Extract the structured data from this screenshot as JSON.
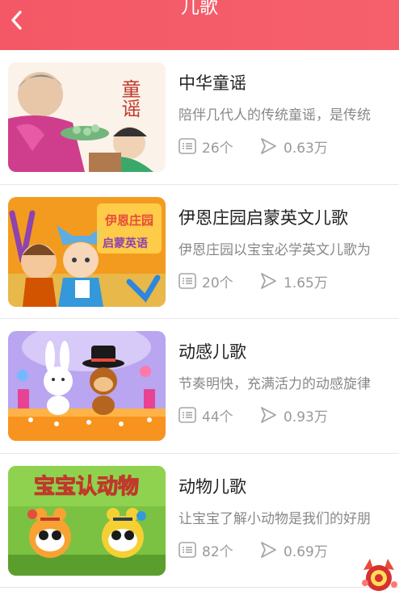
{
  "header": {
    "title": "儿歌"
  },
  "items": [
    {
      "title": "中华童谣",
      "desc": "陪伴几代人的传统童谣，是传统",
      "count": "26个",
      "plays": "0.63万",
      "thumb_text": "童谣"
    },
    {
      "title": "伊恩庄园启蒙英文儿歌",
      "desc": "伊恩庄园以宝宝必学英文儿歌为",
      "count": "20个",
      "plays": "1.65万",
      "thumb_text": "伊恩庄园",
      "thumb_sub": "启蒙英语"
    },
    {
      "title": "动感儿歌",
      "desc": "节奏明快，充满活力的动感旋律",
      "count": "44个",
      "plays": "0.93万"
    },
    {
      "title": "动物儿歌",
      "desc": "让宝宝了解小动物是我们的好朋",
      "count": "82个",
      "plays": "0.69万",
      "thumb_text": "宝宝认动物"
    }
  ],
  "colors": {
    "header": "#f45866",
    "title": "#222222",
    "desc": "#888888",
    "stat": "#999999"
  }
}
